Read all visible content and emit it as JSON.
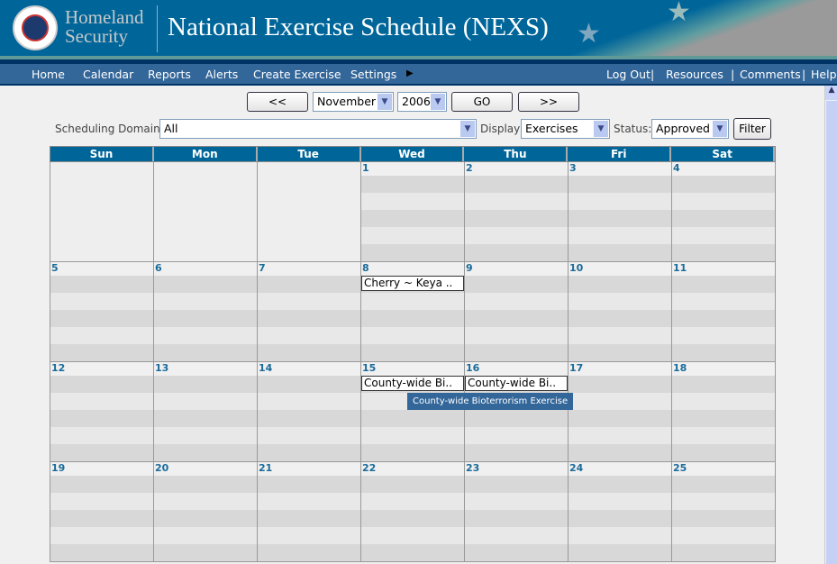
{
  "header": {
    "agency_line1": "Homeland",
    "agency_line2": "Security",
    "title": "National Exercise Schedule (NEXS)"
  },
  "nav": {
    "left": [
      "Home",
      "Calendar",
      "Reports",
      "Alerts",
      "Create Exercise",
      "Settings"
    ],
    "right": [
      "Log Out",
      "|",
      "Resources",
      "|",
      "Comments",
      "|",
      "Help"
    ]
  },
  "controls": {
    "prev": "<<",
    "month": "November",
    "year": "2006",
    "go": "GO",
    "next": ">>",
    "domain_label": "Scheduling Domain:",
    "domain": "All",
    "display_label": "Display",
    "display": "Exercises",
    "status_label": "Status:",
    "status": "Approved",
    "filter": "Filter"
  },
  "calendar": {
    "days": [
      "Sun",
      "Mon",
      "Tue",
      "Wed",
      "Thu",
      "Fri",
      "Sat"
    ],
    "weeks": [
      [
        "",
        "",
        "",
        "1",
        "2",
        "3",
        "4"
      ],
      [
        "5",
        "6",
        "7",
        "8",
        "9",
        "10",
        "11"
      ],
      [
        "12",
        "13",
        "14",
        "15",
        "16",
        "17",
        "18"
      ],
      [
        "19",
        "20",
        "21",
        "22",
        "23",
        "24",
        "25"
      ]
    ],
    "events": [
      {
        "day": "8",
        "label": "Cherry ~ Keya .."
      },
      {
        "day": "15",
        "label": "County-wide Bi.."
      },
      {
        "day": "16",
        "label": "County-wide Bi.."
      }
    ],
    "tooltip": "County-wide Bioterrorism Exercise"
  }
}
